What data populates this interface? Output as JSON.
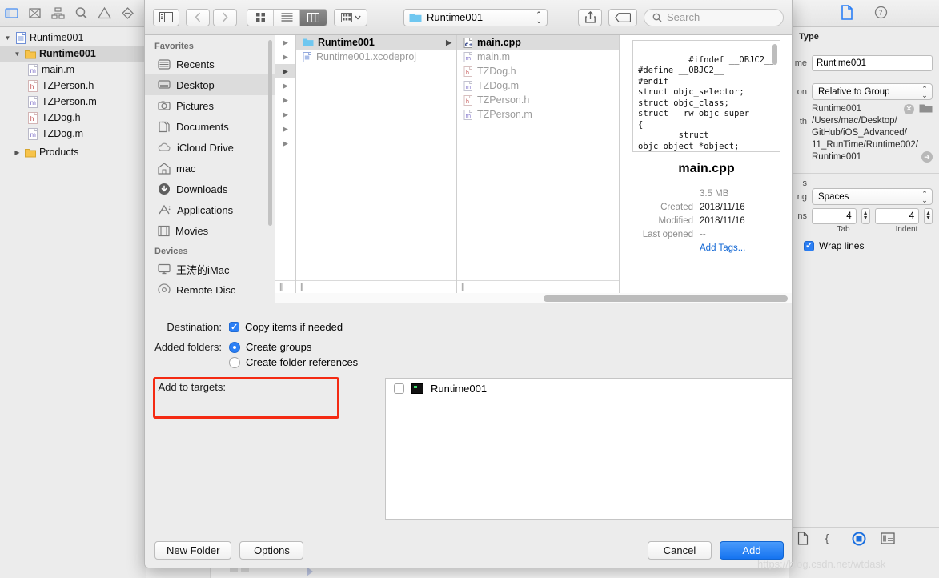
{
  "colors": {
    "accent": "#1573f0",
    "highlight_box": "#f42a12",
    "selection": "#dcdcdc",
    "folder": "#f7c34a"
  },
  "navigator": {
    "toolbar_icons": [
      "folder-icon",
      "issue-icon",
      "hierarchy-icon",
      "search-icon",
      "warning-icon",
      "breakpoint-icon"
    ],
    "items": [
      {
        "label": "Runtime001",
        "icon": "xcode-project-icon",
        "twisty": "▼",
        "depth": 0,
        "selected": false,
        "bold": false
      },
      {
        "label": "Runtime001",
        "icon": "folder-icon",
        "twisty": "▼",
        "depth": 1,
        "selected": true,
        "bold": true
      },
      {
        "label": "main.m",
        "icon": "m-file-icon",
        "twisty": "",
        "depth": 2,
        "selected": false,
        "bold": false
      },
      {
        "label": "TZPerson.h",
        "icon": "h-file-icon",
        "twisty": "",
        "depth": 2,
        "selected": false,
        "bold": false
      },
      {
        "label": "TZPerson.m",
        "icon": "m-file-icon",
        "twisty": "",
        "depth": 2,
        "selected": false,
        "bold": false
      },
      {
        "label": "TZDog.h",
        "icon": "h-file-icon",
        "twisty": "",
        "depth": 2,
        "selected": false,
        "bold": false
      },
      {
        "label": "TZDog.m",
        "icon": "m-file-icon",
        "twisty": "",
        "depth": 2,
        "selected": false,
        "bold": false
      },
      {
        "label": "Products",
        "icon": "folder-icon",
        "twisty": "▶",
        "depth": 1,
        "selected": false,
        "bold": false
      }
    ]
  },
  "inspector": {
    "tabs": [
      "file-inspector-icon",
      "quick-help-icon"
    ],
    "identity_title": "Type",
    "name_label": "me",
    "name_value": "Runtime001",
    "location_label": "on",
    "location_value": "Relative to Group",
    "location_file": "Runtime001",
    "fullpath_label": "th",
    "fullpath_lines": [
      "/Users/mac/Desktop/",
      "GitHub/iOS_Advanced/",
      "11_RunTime/Runtime002/",
      "Runtime001"
    ],
    "text_settings_label": "s",
    "indent_using_label": "ng",
    "indent_using_value": "Spaces",
    "widths_label": "ns",
    "tab_value": "4",
    "tab_sub_label": "Tab",
    "indent_value": "4",
    "indent_sub_label": "Indent",
    "wrap_lines_label": "Wrap lines",
    "wrap_lines_checked": true,
    "bottom_icons": [
      "file-template-icon",
      "code-snippet-icon",
      "media-library-icon",
      "object-library-icon"
    ]
  },
  "sheet": {
    "toolbar": {
      "sidebar_toggle_icon": "sidebar-toggle-icon",
      "back_icon": "chevron-left-icon",
      "forward_icon": "chevron-right-icon",
      "view_modes": [
        {
          "icon": "icon-view-icon",
          "active": false
        },
        {
          "icon": "list-view-icon",
          "active": false
        },
        {
          "icon": "column-view-icon",
          "active": true
        }
      ],
      "group_icon": "group-by-icon",
      "group_chevron": "chevron-down-icon",
      "path_label": "Runtime001",
      "path_icon": "folder-icon",
      "share_icon": "share-icon",
      "tag_icon": "tag-icon",
      "search_icon": "search-icon",
      "search_placeholder": "Search"
    },
    "favorites": {
      "section_favorites": "Favorites",
      "section_devices": "Devices",
      "items": [
        {
          "label": "Recents",
          "icon": "recents-icon",
          "selected": false
        },
        {
          "label": "Desktop",
          "icon": "desktop-icon",
          "selected": true
        },
        {
          "label": "Pictures",
          "icon": "pictures-icon",
          "selected": false
        },
        {
          "label": "Documents",
          "icon": "documents-icon",
          "selected": false
        },
        {
          "label": "iCloud Drive",
          "icon": "cloud-icon",
          "selected": false
        },
        {
          "label": "mac",
          "icon": "home-icon",
          "selected": false
        },
        {
          "label": "Downloads",
          "icon": "downloads-icon",
          "selected": false
        },
        {
          "label": "Applications",
          "icon": "applications-icon",
          "selected": false
        },
        {
          "label": "Movies",
          "icon": "movies-icon",
          "selected": false
        }
      ],
      "devices": [
        {
          "label": "王涛的iMac",
          "icon": "imac-icon",
          "selected": false
        },
        {
          "label": "Remote Disc",
          "icon": "disc-icon",
          "selected": false
        }
      ]
    },
    "column_partial_arrows": [
      {
        "selected": false
      },
      {
        "selected": false
      },
      {
        "selected": true
      },
      {
        "selected": false
      },
      {
        "selected": false
      },
      {
        "selected": false
      },
      {
        "selected": false
      },
      {
        "selected": false
      }
    ],
    "column_a": [
      {
        "label": "Runtime001",
        "icon": "folder-icon",
        "selected": true,
        "has_children": true
      },
      {
        "label": "Runtime001.xcodeproj",
        "icon": "xcode-project-icon",
        "selected": false,
        "has_children": false
      }
    ],
    "column_b": [
      {
        "label": "main.cpp",
        "icon": "cpp-file-icon",
        "selected": true,
        "has_children": false
      },
      {
        "label": "main.m",
        "icon": "m-file-icon",
        "selected": false,
        "has_children": false
      },
      {
        "label": "TZDog.h",
        "icon": "h-file-icon",
        "selected": false,
        "has_children": false
      },
      {
        "label": "TZDog.m",
        "icon": "m-file-icon",
        "selected": false,
        "has_children": false
      },
      {
        "label": "TZPerson.h",
        "icon": "h-file-icon",
        "selected": false,
        "has_children": false
      },
      {
        "label": "TZPerson.m",
        "icon": "m-file-icon",
        "selected": false,
        "has_children": false
      }
    ],
    "preview": {
      "code": "#ifndef __OBJC2__\n#define __OBJC2__\n#endif\nstruct objc_selector;\nstruct objc_class;\nstruct __rw_objc_super\n{\n        struct\nobjc_object *object;\n        struct\nobjc_object",
      "title": "main.cpp",
      "size": "3.5 MB",
      "meta": [
        {
          "key": "",
          "value": "3.5 MB",
          "style": "grey"
        },
        {
          "key": "Created",
          "value": "2018/11/16",
          "style": "normal"
        },
        {
          "key": "Modified",
          "value": "2018/11/16",
          "style": "normal"
        },
        {
          "key": "Last opened",
          "value": "--",
          "style": "normal"
        },
        {
          "key": "",
          "value": "Add Tags...",
          "style": "link"
        }
      ]
    },
    "options": {
      "destination_label": "Destination:",
      "copy_items_label": "Copy items if needed",
      "copy_items_checked": true,
      "added_folders_label": "Added folders:",
      "create_groups_label": "Create groups",
      "create_groups_selected": true,
      "create_folder_refs_label": "Create folder references",
      "create_folder_refs_selected": false,
      "add_to_targets_label": "Add to targets:",
      "targets": [
        {
          "label": "Runtime001",
          "checked": false
        }
      ]
    },
    "footer": {
      "new_folder_label": "New Folder",
      "options_label": "Options",
      "cancel_label": "Cancel",
      "add_label": "Add"
    }
  },
  "watermark": "https://blog.csdn.net/wtdask"
}
